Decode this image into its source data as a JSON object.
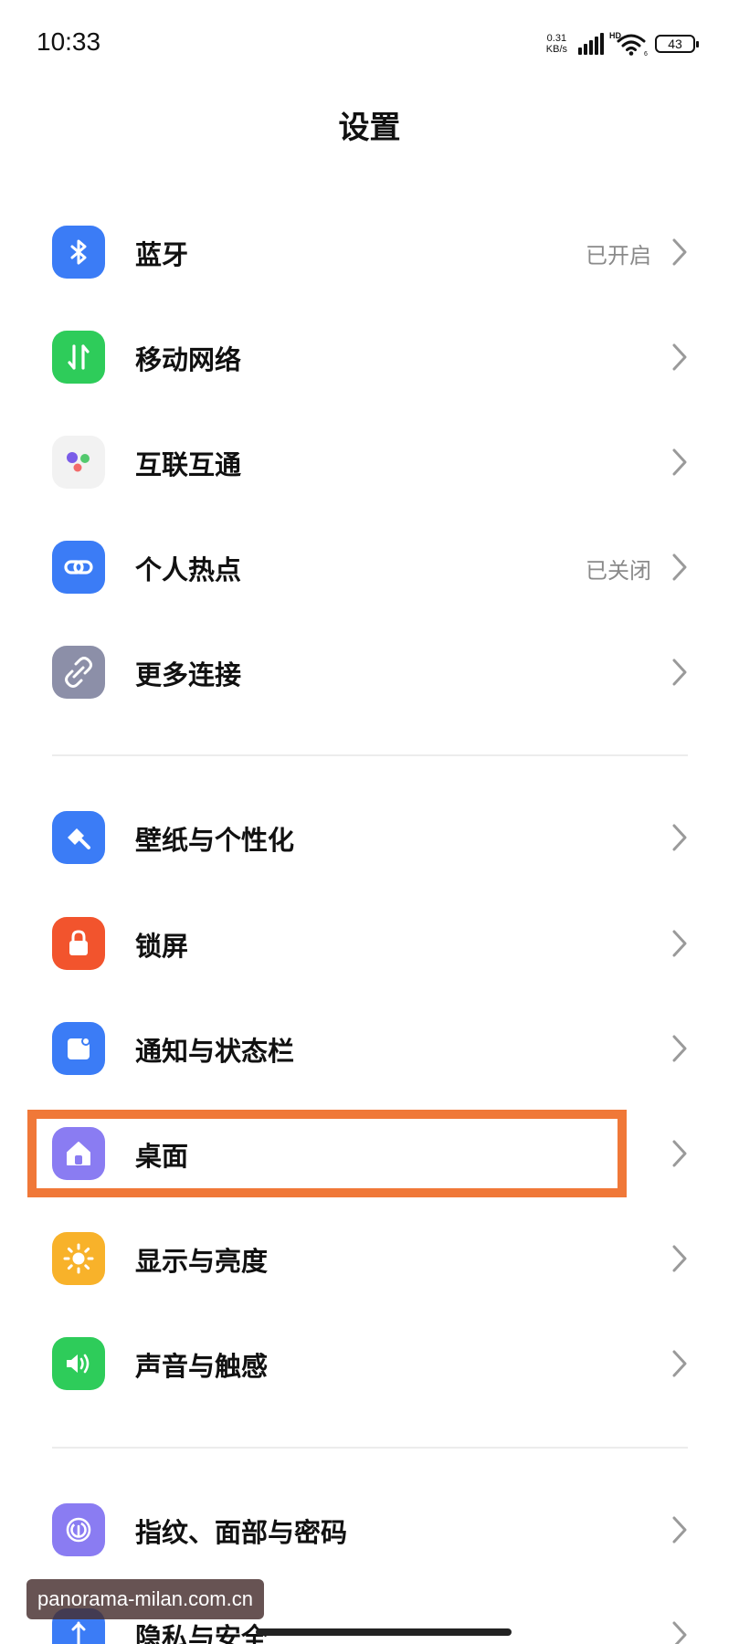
{
  "status_bar": {
    "time": "10:33",
    "speed_value": "0.31",
    "speed_unit": "KB/s",
    "network_type": "HD",
    "wifi_badge": "6",
    "battery": "43"
  },
  "page": {
    "title": "设置"
  },
  "settings": [
    {
      "label": "蓝牙",
      "status": "已开启",
      "icon": "bluetooth-icon",
      "color": "#3B7CF6"
    },
    {
      "label": "移动网络",
      "status": "",
      "icon": "mobile-data-icon",
      "color": "#2ECC5A"
    },
    {
      "label": "互联互通",
      "status": "",
      "icon": "interconnect-icon",
      "color": "#F2F2F2"
    },
    {
      "label": "个人热点",
      "status": "已关闭",
      "icon": "hotspot-link-icon",
      "color": "#3B7CF6"
    },
    {
      "label": "更多连接",
      "status": "",
      "icon": "more-connections-icon",
      "color": "#8C8FA8"
    },
    {
      "label": "壁纸与个性化",
      "status": "",
      "icon": "wallpaper-brush-icon",
      "color": "#3B7CF6"
    },
    {
      "label": "锁屏",
      "status": "",
      "icon": "lock-icon",
      "color": "#F2542D"
    },
    {
      "label": "通知与状态栏",
      "status": "",
      "icon": "notification-icon",
      "color": "#3B7CF6"
    },
    {
      "label": "桌面",
      "status": "",
      "icon": "home-icon",
      "color": "#8A7CF2"
    },
    {
      "label": "显示与亮度",
      "status": "",
      "icon": "brightness-icon",
      "color": "#F8B22A"
    },
    {
      "label": "声音与触感",
      "status": "",
      "icon": "sound-icon",
      "color": "#2ECC5A"
    },
    {
      "label": "指纹、面部与密码",
      "status": "",
      "icon": "fingerprint-icon",
      "color": "#8A7CF2"
    },
    {
      "label": "隐私与安全",
      "status": "",
      "icon": "privacy-shield-icon",
      "color": "#3B7CF6"
    }
  ],
  "watermark": "panorama-milan.com.cn"
}
